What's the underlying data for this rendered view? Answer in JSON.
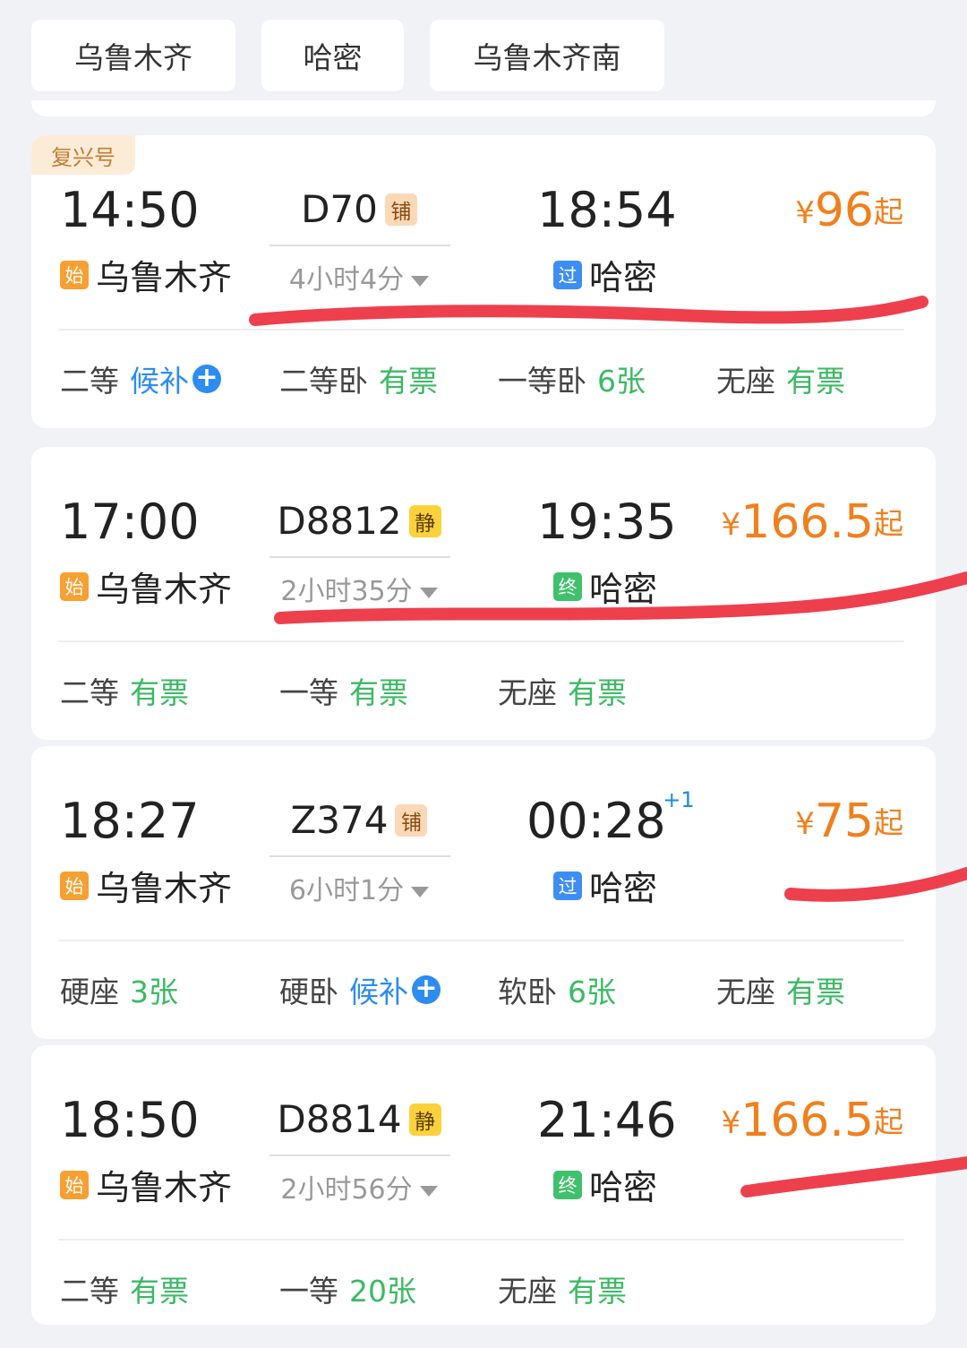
{
  "filters": [
    "乌鲁木齐",
    "哈密",
    "乌鲁木齐南"
  ],
  "train_list": [
    {
      "badge": "复兴号",
      "dep_time": "14:50",
      "dep_tag": "始",
      "dep_station": "乌鲁木齐",
      "train_no": "D70",
      "train_tag": "铺",
      "duration": "4小时4分",
      "arr_time": "18:54",
      "arr_plus": "",
      "arr_tag": "过",
      "arr_station": "哈密",
      "price_yen": "¥",
      "price_value": "96",
      "price_suffix": "起",
      "seats": [
        {
          "type": "二等",
          "status": "候补",
          "status_color": "#2c8cf0",
          "waitlist": true
        },
        {
          "type": "二等卧",
          "status": "有票",
          "status_color": "#3cb964",
          "waitlist": false
        },
        {
          "type": "一等卧",
          "status": "6张",
          "status_color": "#3cb964",
          "waitlist": false
        },
        {
          "type": "无座",
          "status": "有票",
          "status_color": "#3cb964",
          "waitlist": false
        }
      ]
    },
    {
      "badge": "",
      "dep_time": "17:00",
      "dep_tag": "始",
      "dep_station": "乌鲁木齐",
      "train_no": "D8812",
      "train_tag": "静",
      "duration": "2小时35分",
      "arr_time": "19:35",
      "arr_plus": "",
      "arr_tag": "终",
      "arr_station": "哈密",
      "price_yen": "¥",
      "price_value": "166.5",
      "price_suffix": "起",
      "seats": [
        {
          "type": "二等",
          "status": "有票",
          "status_color": "#3cb964",
          "waitlist": false
        },
        {
          "type": "一等",
          "status": "有票",
          "status_color": "#3cb964",
          "waitlist": false
        },
        {
          "type": "无座",
          "status": "有票",
          "status_color": "#3cb964",
          "waitlist": false
        }
      ]
    },
    {
      "badge": "",
      "dep_time": "18:27",
      "dep_tag": "始",
      "dep_station": "乌鲁木齐",
      "train_no": "Z374",
      "train_tag": "铺",
      "duration": "6小时1分",
      "arr_time": "00:28",
      "arr_plus": "+1",
      "arr_tag": "过",
      "arr_station": "哈密",
      "price_yen": "¥",
      "price_value": "75",
      "price_suffix": "起",
      "seats": [
        {
          "type": "硬座",
          "status": "3张",
          "status_color": "#3cb964",
          "waitlist": false
        },
        {
          "type": "硬卧",
          "status": "候补",
          "status_color": "#2c8cf0",
          "waitlist": true
        },
        {
          "type": "软卧",
          "status": "6张",
          "status_color": "#3cb964",
          "waitlist": false
        },
        {
          "type": "无座",
          "status": "有票",
          "status_color": "#3cb964",
          "waitlist": false
        }
      ]
    },
    {
      "badge": "",
      "dep_time": "18:50",
      "dep_tag": "始",
      "dep_station": "乌鲁木齐",
      "train_no": "D8814",
      "train_tag": "静",
      "duration": "2小时56分",
      "arr_time": "21:46",
      "arr_plus": "",
      "arr_tag": "终",
      "arr_station": "哈密",
      "price_yen": "¥",
      "price_value": "166.5",
      "price_suffix": "起",
      "seats": [
        {
          "type": "二等",
          "status": "有票",
          "status_color": "#3cb964",
          "waitlist": false
        },
        {
          "type": "一等",
          "status": "20张",
          "status_color": "#3cb964",
          "waitlist": false
        },
        {
          "type": "无座",
          "status": "有票",
          "status_color": "#3cb964",
          "waitlist": false
        }
      ]
    }
  ],
  "colors": {
    "price": "#f0801d",
    "available": "#3cb964",
    "waitlist": "#2c8cf0",
    "annotation": "#ee3f4d"
  }
}
